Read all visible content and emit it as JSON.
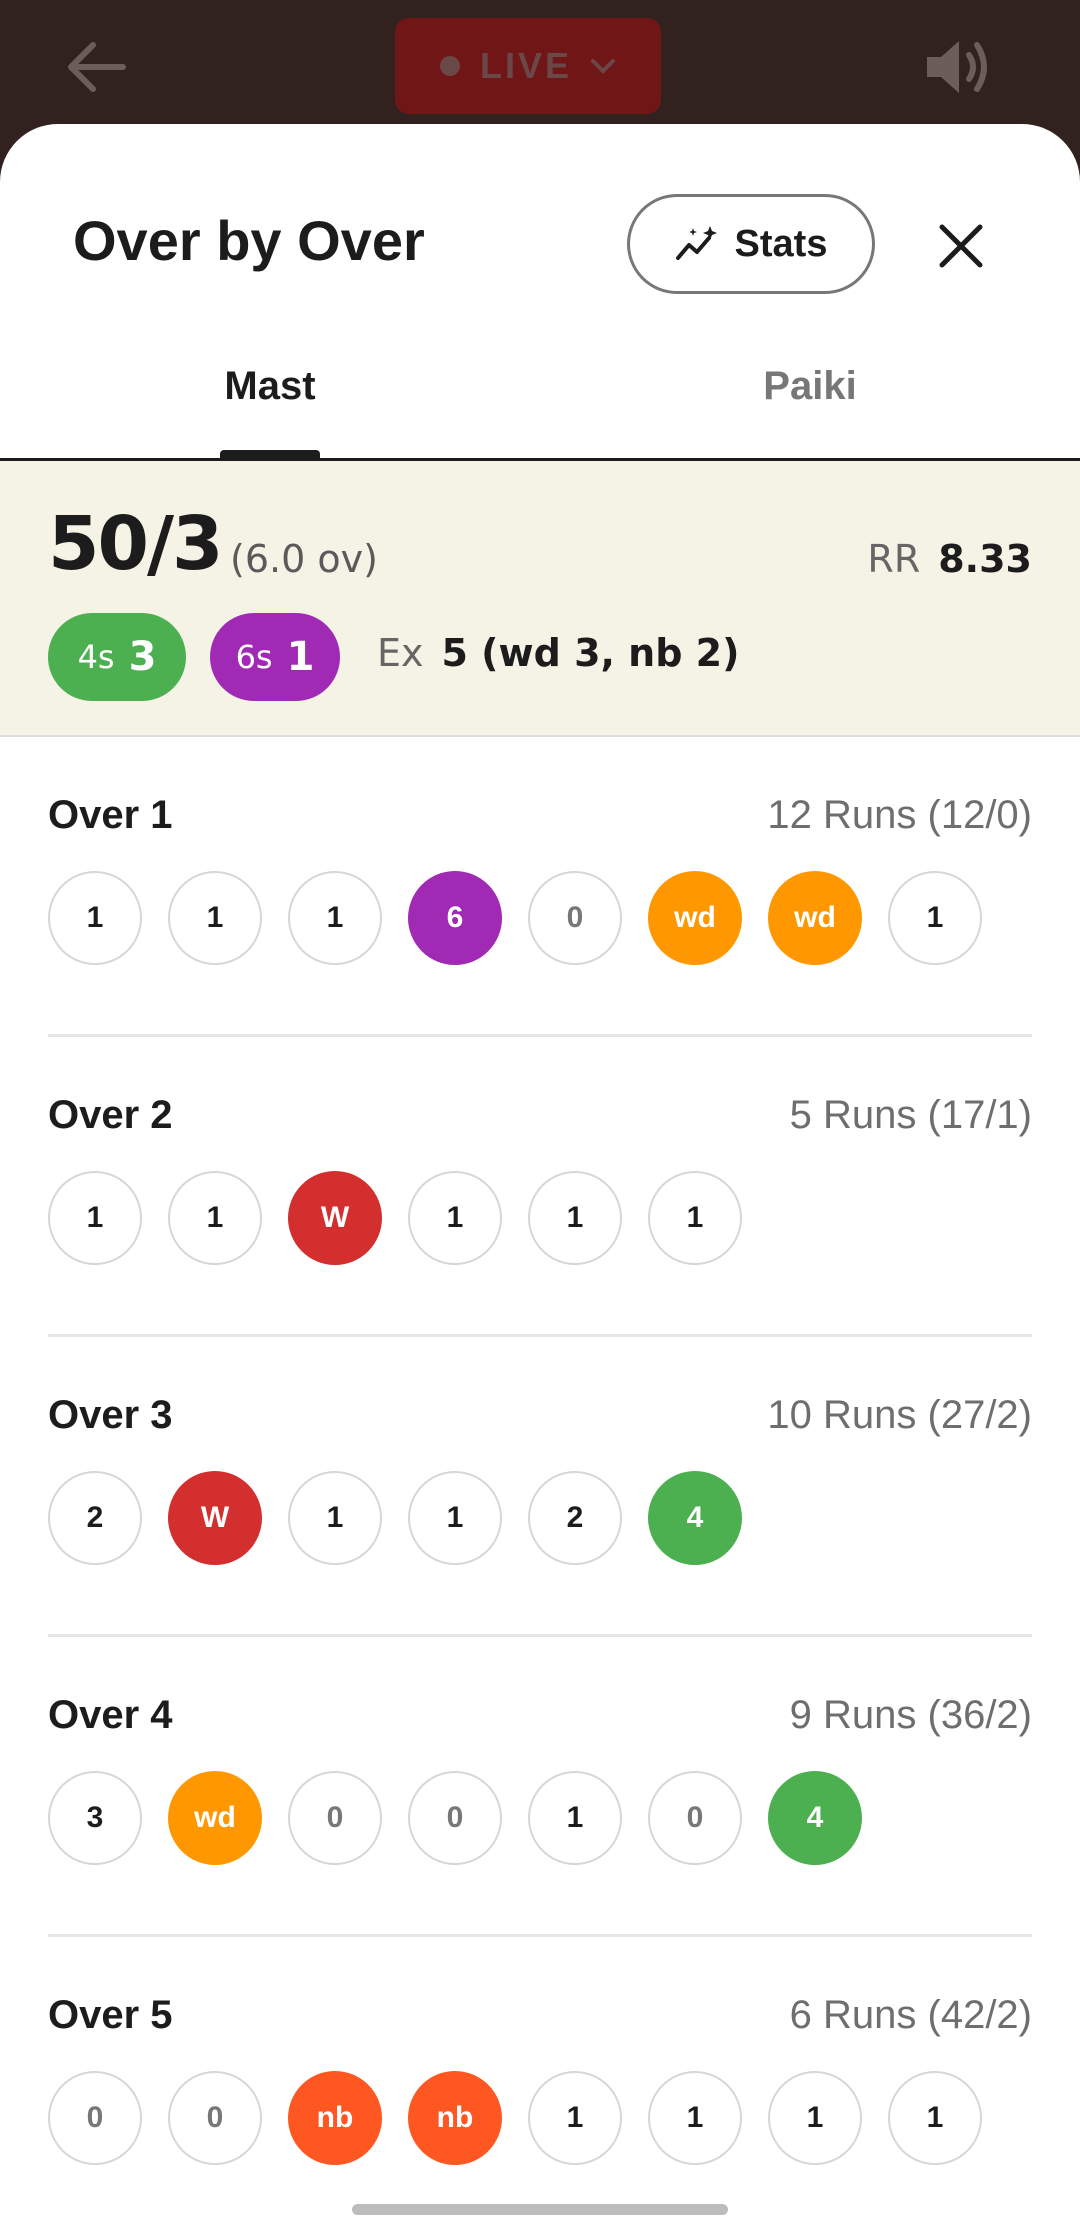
{
  "topbar": {
    "live_label": "LIVE"
  },
  "sheet": {
    "title": "Over by Over",
    "stats_label": "Stats",
    "tabs": [
      {
        "label": "Mast",
        "active": true
      },
      {
        "label": "Paiki",
        "active": false
      }
    ]
  },
  "summary": {
    "score": "50/3",
    "overs": "(6.0 ov)",
    "rr_label": "RR",
    "rr_value": "8.33",
    "fours_label": "4s",
    "fours_value": "3",
    "sixes_label": "6s",
    "sixes_value": "1",
    "extras_label": "Ex",
    "extras_value": "5 (wd 3, nb 2)"
  },
  "overs_list": [
    {
      "title": "Over 1",
      "runs": "12 Runs (12/0)",
      "balls": [
        {
          "v": "1",
          "t": "run"
        },
        {
          "v": "1",
          "t": "run"
        },
        {
          "v": "1",
          "t": "run"
        },
        {
          "v": "6",
          "t": "six"
        },
        {
          "v": "0",
          "t": "dot"
        },
        {
          "v": "wd",
          "t": "wide"
        },
        {
          "v": "wd",
          "t": "wide"
        },
        {
          "v": "1",
          "t": "run"
        }
      ]
    },
    {
      "title": "Over 2",
      "runs": "5 Runs (17/1)",
      "balls": [
        {
          "v": "1",
          "t": "run"
        },
        {
          "v": "1",
          "t": "run"
        },
        {
          "v": "W",
          "t": "wicket"
        },
        {
          "v": "1",
          "t": "run"
        },
        {
          "v": "1",
          "t": "run"
        },
        {
          "v": "1",
          "t": "run"
        }
      ]
    },
    {
      "title": "Over 3",
      "runs": "10 Runs (27/2)",
      "balls": [
        {
          "v": "2",
          "t": "run"
        },
        {
          "v": "W",
          "t": "wicket"
        },
        {
          "v": "1",
          "t": "run"
        },
        {
          "v": "1",
          "t": "run"
        },
        {
          "v": "2",
          "t": "run"
        },
        {
          "v": "4",
          "t": "four"
        }
      ]
    },
    {
      "title": "Over 4",
      "runs": "9 Runs (36/2)",
      "balls": [
        {
          "v": "3",
          "t": "run"
        },
        {
          "v": "wd",
          "t": "wide"
        },
        {
          "v": "0",
          "t": "dot"
        },
        {
          "v": "0",
          "t": "dot"
        },
        {
          "v": "1",
          "t": "run"
        },
        {
          "v": "0",
          "t": "dot"
        },
        {
          "v": "4",
          "t": "four"
        }
      ]
    },
    {
      "title": "Over 5",
      "runs": "6 Runs (42/2)",
      "balls": [
        {
          "v": "0",
          "t": "dot"
        },
        {
          "v": "0",
          "t": "dot"
        },
        {
          "v": "nb",
          "t": "noball"
        },
        {
          "v": "nb",
          "t": "noball"
        },
        {
          "v": "1",
          "t": "run"
        },
        {
          "v": "1",
          "t": "run"
        },
        {
          "v": "1",
          "t": "run"
        },
        {
          "v": "1",
          "t": "run"
        }
      ]
    }
  ],
  "colors": {
    "four": "#4caf50",
    "six": "#a02ab4",
    "wide": "#ff9800",
    "wicket": "#d32f2f",
    "noball": "#ff5722",
    "live": "#701616",
    "background": "#32221f"
  },
  "icons": {
    "back": "back-arrow-icon",
    "speaker": "speaker-icon",
    "stats": "trend-sparkle-icon",
    "close": "close-icon",
    "live_chevron": "chevron-down-icon"
  }
}
